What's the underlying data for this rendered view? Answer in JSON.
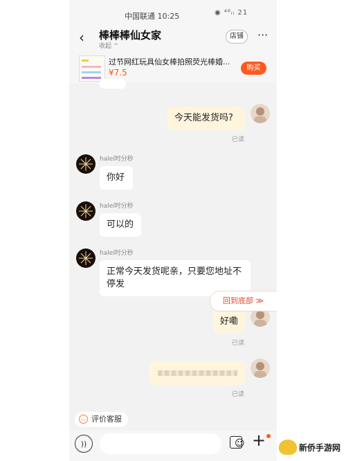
{
  "status_bar": {
    "carrier_time": "中国联通 10:25",
    "indicators": "◉ ⁴⁶ᵢₗ 21"
  },
  "header": {
    "title": "棒棒棒仙女家",
    "collapse_label": "收起 ^",
    "back_icon": "chevron-left-icon",
    "store_label": "店铺",
    "more_label": "···"
  },
  "product": {
    "title": "过节网红玩具仙女棒拍照荧光棒婚...",
    "price": "¥7.5",
    "buy_label": "购买"
  },
  "messages": [
    {
      "from": "me",
      "text": "今天能发货吗?",
      "status": "已读"
    },
    {
      "from": "seller",
      "sender": "haleí时分秒",
      "text": "你好"
    },
    {
      "from": "seller",
      "sender": "haleí时分秒",
      "text": "可以的"
    },
    {
      "from": "seller",
      "sender": "haleí时分秒",
      "text": "正常今天发货呢亲，只要您地址不停发"
    },
    {
      "from": "me",
      "text": "好嘞",
      "status": "已读"
    },
    {
      "from": "me",
      "text": "",
      "status": "已读",
      "blurred": true
    }
  ],
  "jump_bottom_label": "回到底部 ≫",
  "eval_label": "评价客服",
  "input": {
    "voice_label": "))",
    "emoji_label": "☺",
    "plus_label": "+"
  },
  "watermark": {
    "text": "新侨手游网"
  },
  "colors": {
    "accent": "#ff5a1f",
    "bubble_out": "#fff5dd",
    "bubble_in": "#ffffff",
    "background": "#f2f2f2"
  }
}
